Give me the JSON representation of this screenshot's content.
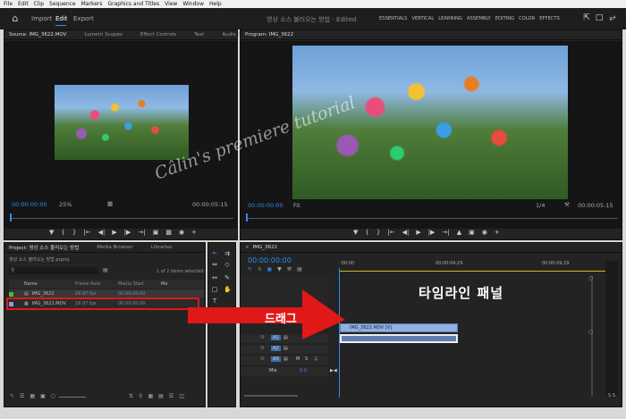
{
  "menu": [
    "File",
    "Edit",
    "Clip",
    "Sequence",
    "Markers",
    "Graphics and Titles",
    "View",
    "Window",
    "Help"
  ],
  "header": {
    "tabs": [
      "Import",
      "Edit",
      "Export"
    ],
    "doc_title": "영상 소스 불러오는 방법 - Edited",
    "workspaces": [
      "ESSENTIALS",
      "VERTICAL",
      "LEARNING",
      "ASSEMBLY",
      "EDITING",
      "COLOR",
      "EFFECTS"
    ]
  },
  "source": {
    "tabs": [
      "Source: IMG_3622.MOV",
      "Lumetri Scopes",
      "Effect Controls",
      "Text",
      "Audio Cli"
    ],
    "timecode_in": "00:00:00:00",
    "zoom": "25%",
    "timecode_dur": "00:00:05:15"
  },
  "program": {
    "tab": "Program: IMG_3622",
    "timecode_in": "00:00:00:00",
    "fit": "Fit",
    "fraction": "1/4",
    "timecode_dur": "00:00:05:15"
  },
  "project": {
    "tabs": [
      "Project: 영상 소스 불러오는 방법",
      "Media Browser",
      "Libraries"
    ],
    "file": "영상 소스 불러오는 방법.prproj",
    "selection": "1 of 2 items selected",
    "columns": [
      "Name",
      "Frame Rate",
      "Media Start",
      "Me"
    ],
    "rows": [
      {
        "name": "IMG_3622",
        "fr": "29.97 fps",
        "ms": "00:00:00:00"
      },
      {
        "name": "IMG_3622.MOV",
        "fr": "29.97 fps",
        "ms": "00:00:00:00"
      }
    ]
  },
  "timeline": {
    "tab": "IMG_3622",
    "timecode": "00:00:00:00",
    "ruler": [
      ":00:00",
      "00:00:04:29",
      "00:00:09:29"
    ],
    "clip_video": "IMG_3622.MOV [V]",
    "tracks": [
      "V1",
      "A1",
      "A2",
      "A3"
    ],
    "mix_label": "Mix",
    "mix_value": "0.0",
    "meter": "S S"
  },
  "annotations": {
    "timeline_panel": "타임라인 패널",
    "drag": "드래그",
    "watermark": "Câlin's premiere tutorial"
  },
  "colors": {
    "accent": "#2d8ceb",
    "annotation": "#e01818"
  }
}
